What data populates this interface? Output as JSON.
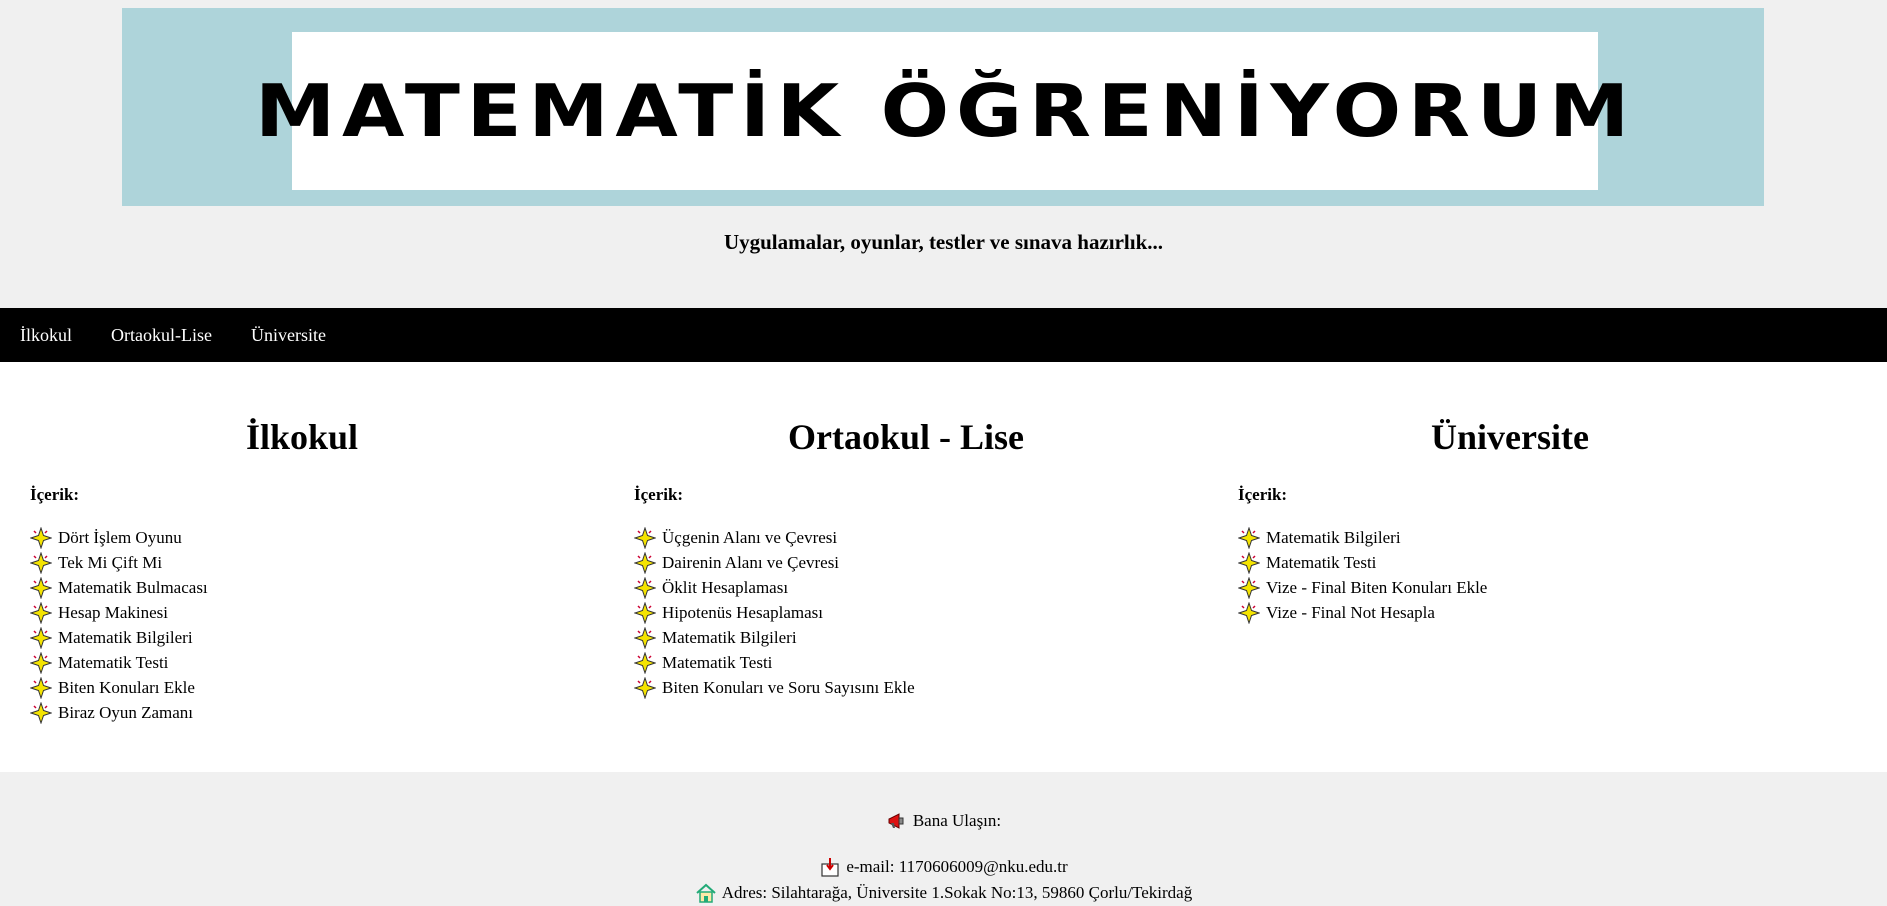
{
  "header": {
    "banner_title": "MATEMATİK ÖĞRENİYORUM",
    "tagline": "Uygulamalar, oyunlar, testler ve sınava hazırlık..."
  },
  "nav": {
    "items": [
      {
        "label": "İlkokul"
      },
      {
        "label": "Ortaokul-Lise"
      },
      {
        "label": "Üniversite"
      }
    ]
  },
  "columns": [
    {
      "title": "İlkokul",
      "label": "İçerik:",
      "items": [
        "Dört İşlem Oyunu",
        "Tek Mi Çift Mi",
        "Matematik Bulmacası",
        "Hesap Makinesi",
        "Matematik Bilgileri",
        "Matematik Testi",
        "Biten Konuları Ekle",
        "Biraz Oyun Zamanı"
      ]
    },
    {
      "title": "Ortaokul - Lise",
      "label": "İçerik:",
      "items": [
        "Üçgenin Alanı ve Çevresi",
        "Dairenin Alanı ve Çevresi",
        "Öklit Hesaplaması",
        "Hipotenüs Hesaplaması",
        "Matematik Bilgileri",
        "Matematik Testi",
        "Biten Konuları ve Soru Sayısını Ekle"
      ]
    },
    {
      "title": "Üniversite",
      "label": "İçerik:",
      "items": [
        "Matematik Bilgileri",
        "Matematik Testi",
        "Vize - Final Biten Konuları Ekle",
        "Vize - Final Not Hesapla"
      ]
    }
  ],
  "footer": {
    "contact_label": "Bana Ulaşın:",
    "email": "e-mail: 1170606009@nku.edu.tr",
    "address": "Adres: Silahtarağa, Üniversite 1.Sokak No:13, 59860 Çorlu/Tekirdağ"
  },
  "colors": {
    "banner_bg": "#aed4da",
    "header_bg": "#f0f0f0",
    "nav_bg": "#000000",
    "star_yellow": "#f5e400"
  },
  "icons": {
    "list_bullet": "sparkle-star-icon",
    "contact": "megaphone-icon",
    "email": "mailbox-icon",
    "address": "house-icon"
  }
}
